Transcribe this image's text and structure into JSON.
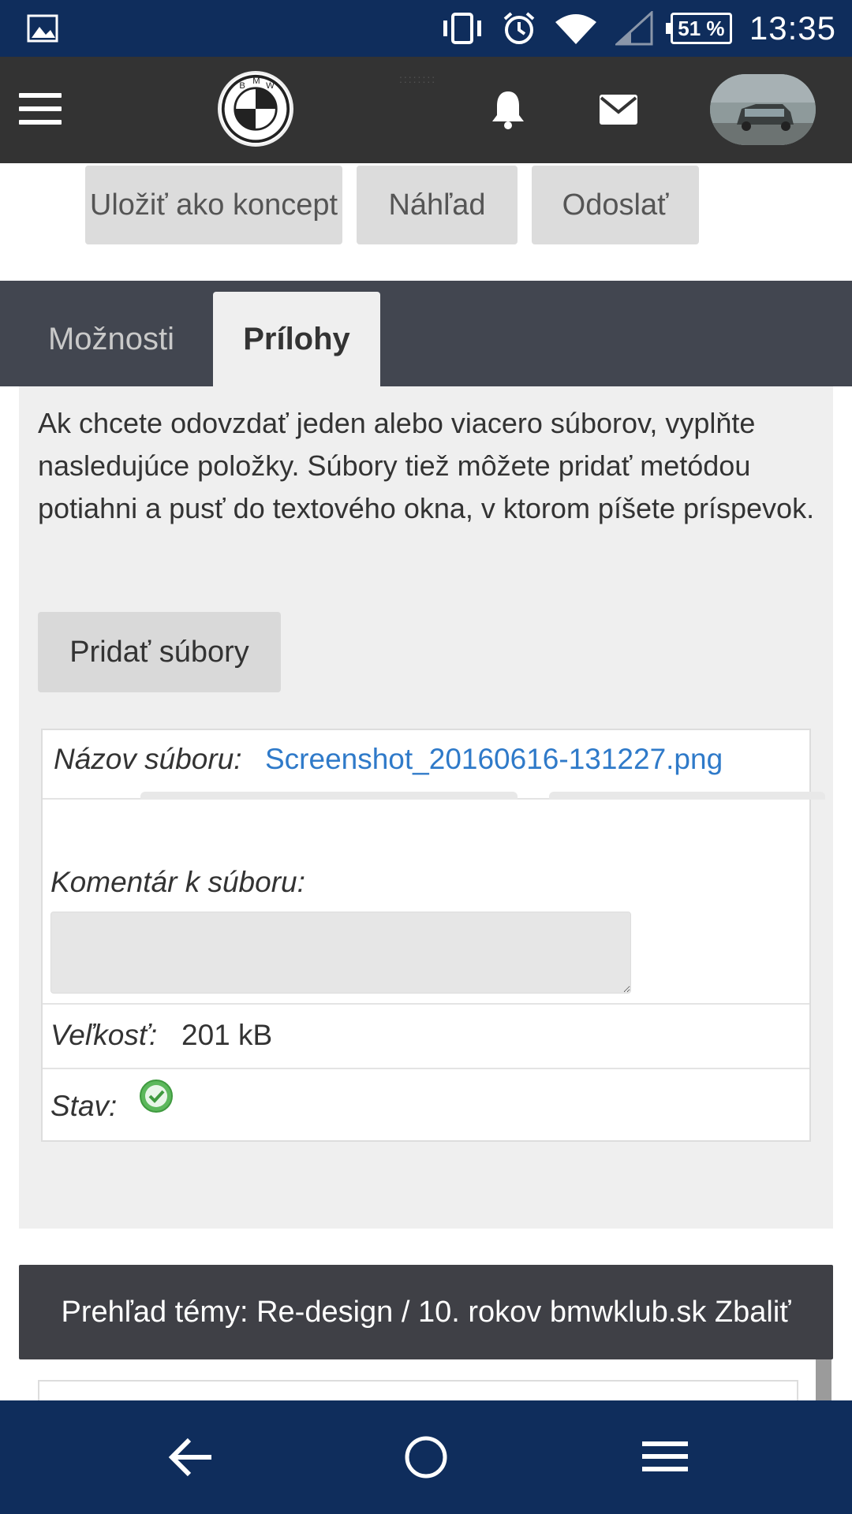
{
  "status_bar": {
    "battery": "51 %",
    "time": "13:35",
    "icons": [
      "image-icon",
      "vibrate-icon",
      "alarm-icon",
      "wifi-icon",
      "signal-icon",
      "battery-icon"
    ]
  },
  "app_bar": {
    "logo_text": "BMW",
    "icons": [
      "menu-icon",
      "bell-icon",
      "mail-icon"
    ]
  },
  "actions": {
    "save_draft": "Uložiť ako koncept",
    "preview": "Náhľad",
    "submit": "Odoslať"
  },
  "tabs": [
    {
      "label": "Možnosti",
      "active": false
    },
    {
      "label": "Prílohy",
      "active": true
    }
  ],
  "attachments": {
    "intro": "Ak chcete odovzdať jeden alebo viacero súborov, vyplňte nasledujúce položky. Súbory tiež môžete pridať metódou potiahni a pusť do textového okna, v ktorom píšete príspevok.",
    "add_files": "Pridať súbory",
    "file": {
      "name_label": "Názov súboru:",
      "name_value": "Screenshot_20160616-131227.png",
      "comment_label": "Komentár k súboru:",
      "comment_value": "",
      "size_label": "Veľkosť:",
      "size_value": "201 kB",
      "state_label": "Stav:"
    }
  },
  "topic_overview": "Prehľad témy: Re-design / 10. rokov bmwklub.sk Zbaliť",
  "nav_bar": [
    "back-icon",
    "home-icon",
    "recent-apps-icon"
  ],
  "colors": {
    "status_bar": "#0f2d5c",
    "app_bar": "#333333",
    "tabs_bar": "#424650",
    "link": "#2f7ac9",
    "ok_green": "#5cb85c"
  }
}
